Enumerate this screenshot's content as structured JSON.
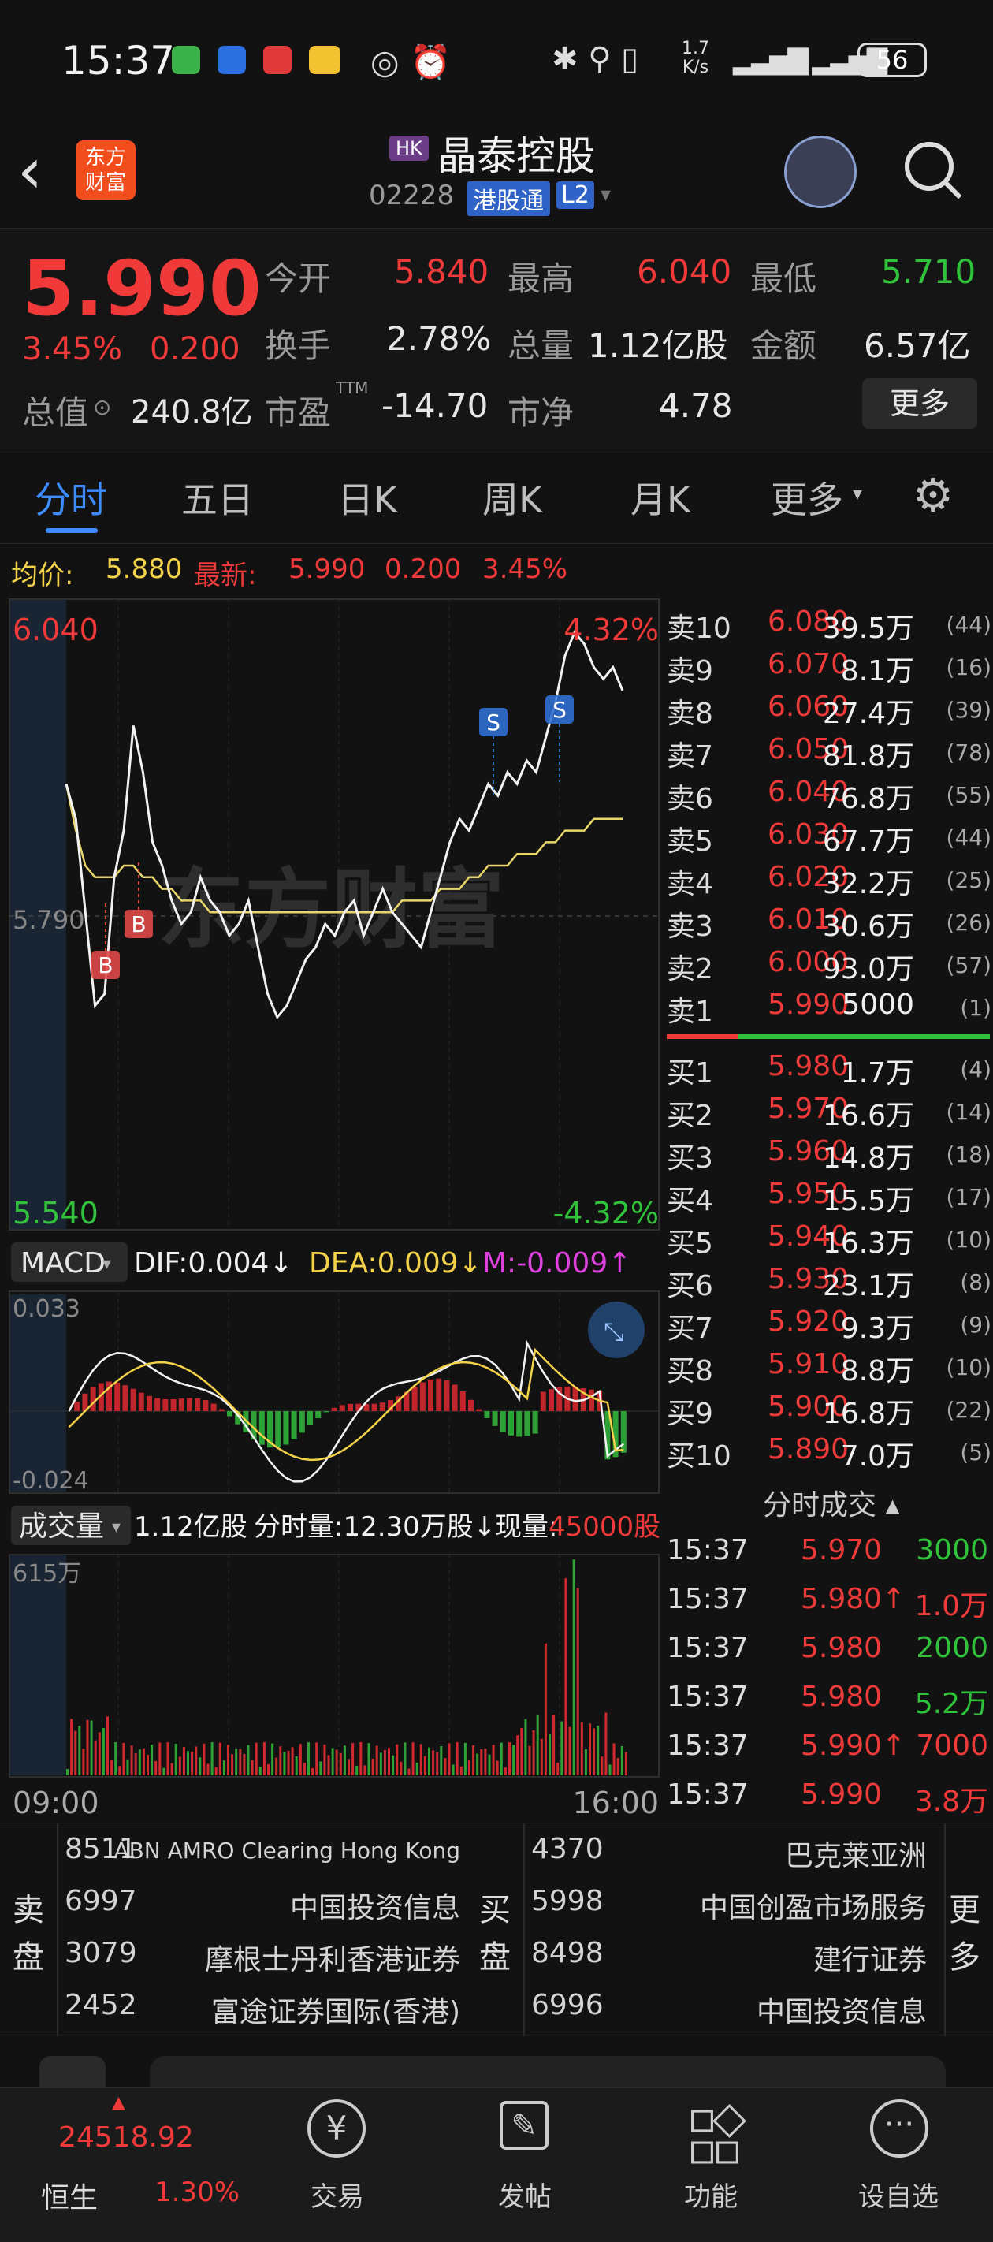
{
  "status_bar": {
    "time": "15:37",
    "net_speed_top": "1.7",
    "net_speed_unit": "K/s",
    "battery": "56"
  },
  "header": {
    "logo_line1": "东方",
    "logo_line2": "财富",
    "market_tag": "HK",
    "stock_name": "晶泰控股",
    "stock_code": "02228",
    "channel_badge": "港股通",
    "level_badge": "L2"
  },
  "quote": {
    "last_price": "5.990",
    "change_pct": "3.45%",
    "change_abs": "0.200",
    "open_label": "今开",
    "open": "5.840",
    "high_label": "最高",
    "high": "6.040",
    "low_label": "最低",
    "low": "5.710",
    "turnover_label": "换手",
    "turnover": "2.78%",
    "volume_label": "总量",
    "volume": "1.12亿股",
    "amount_label": "金额",
    "amount": "6.57亿",
    "mktcap_label": "总值",
    "mktcap": "240.8亿",
    "pe_label": "市盈",
    "pe_sup": "TTM",
    "pe": "-14.70",
    "pb_label": "市净",
    "pb": "4.78",
    "more_button": "更多"
  },
  "tabs": [
    "分时",
    "五日",
    "日K",
    "周K",
    "月K",
    "更多"
  ],
  "active_tab": "分时",
  "price_bar": {
    "avg_label": "均价:",
    "avg": "5.880",
    "latest_label": "最新:",
    "latest": "5.990",
    "chg": "0.200",
    "pct": "3.45%"
  },
  "intraday": {
    "y_max": "6.040",
    "y_min": "5.540",
    "y_mid": "5.790",
    "pct_max": "4.32%",
    "pct_min": "-4.32%",
    "x_start": "09:00",
    "x_end": "16:00",
    "trade_marks": [
      "B",
      "B",
      "S",
      "S"
    ],
    "watermark": "东方财富"
  },
  "macd": {
    "menu": "MACD",
    "dif": "DIF:0.004↓",
    "dea": "DEA:0.009↓",
    "m": "M:-0.009↑",
    "y_top": "0.033",
    "y_bottom": "-0.024"
  },
  "volume_panel": {
    "menu": "成交量",
    "total": "1.12亿股",
    "period": "分时量:12.30万股↓",
    "now_label": "现量:",
    "now": "45000股",
    "y_top": "615万"
  },
  "chart_data": {
    "type": "line",
    "title": "",
    "x_range": [
      "09:00",
      "16:00"
    ],
    "ylim": [
      5.54,
      6.04
    ],
    "series": [
      {
        "name": "",
        "values": [
          5.91,
          5.88,
          5.8,
          5.72,
          5.73,
          5.83,
          5.87,
          5.96,
          5.92,
          5.86,
          5.84,
          5.81,
          5.79,
          5.8,
          5.83,
          5.81,
          5.8,
          5.78,
          5.79,
          5.81,
          5.77,
          5.73,
          5.71,
          5.72,
          5.74,
          5.76,
          5.77,
          5.79,
          5.78,
          5.8,
          5.81,
          5.78,
          5.8,
          5.82,
          5.8,
          5.79,
          5.78,
          5.77,
          5.8,
          5.83,
          5.86,
          5.88,
          5.87,
          5.89,
          5.91,
          5.9,
          5.92,
          5.91,
          5.93,
          5.92,
          5.95,
          5.98,
          6.02,
          6.04,
          6.03,
          6.01,
          6.0,
          6.01,
          5.99
        ]
      },
      {
        "name": "均价",
        "values": [
          5.91,
          5.87,
          5.84,
          5.83,
          5.83,
          5.83,
          5.84,
          5.84,
          5.83,
          5.83,
          5.82,
          5.82,
          5.81,
          5.81,
          5.81,
          5.8,
          5.8,
          5.8,
          5.8,
          5.8,
          5.8,
          5.8,
          5.8,
          5.8,
          5.8,
          5.8,
          5.8,
          5.8,
          5.8,
          5.8,
          5.8,
          5.8,
          5.8,
          5.8,
          5.8,
          5.81,
          5.81,
          5.81,
          5.81,
          5.82,
          5.82,
          5.82,
          5.83,
          5.83,
          5.84,
          5.84,
          5.84,
          5.85,
          5.85,
          5.85,
          5.86,
          5.86,
          5.87,
          5.87,
          5.87,
          5.88,
          5.88,
          5.88,
          5.88
        ]
      }
    ]
  },
  "order_book": {
    "asks": [
      {
        "label": "卖10",
        "price": "6.080",
        "vol": "39.5万",
        "n": "(44)"
      },
      {
        "label": "卖9",
        "price": "6.070",
        "vol": "8.1万",
        "n": "(16)"
      },
      {
        "label": "卖8",
        "price": "6.060",
        "vol": "27.4万",
        "n": "(39)"
      },
      {
        "label": "卖7",
        "price": "6.050",
        "vol": "81.8万",
        "n": "(78)"
      },
      {
        "label": "卖6",
        "price": "6.040",
        "vol": "76.8万",
        "n": "(55)"
      },
      {
        "label": "卖5",
        "price": "6.030",
        "vol": "67.7万",
        "n": "(44)"
      },
      {
        "label": "卖4",
        "price": "6.020",
        "vol": "32.2万",
        "n": "(25)"
      },
      {
        "label": "卖3",
        "price": "6.010",
        "vol": "30.6万",
        "n": "(26)"
      },
      {
        "label": "卖2",
        "price": "6.000",
        "vol": "93.0万",
        "n": "(57)"
      },
      {
        "label": "卖1",
        "price": "5.990",
        "vol": "5000",
        "n": "(1)"
      }
    ],
    "bids": [
      {
        "label": "买1",
        "price": "5.980",
        "vol": "1.7万",
        "n": "(4)"
      },
      {
        "label": "买2",
        "price": "5.970",
        "vol": "16.6万",
        "n": "(14)"
      },
      {
        "label": "买3",
        "price": "5.960",
        "vol": "14.8万",
        "n": "(18)"
      },
      {
        "label": "买4",
        "price": "5.950",
        "vol": "15.5万",
        "n": "(17)"
      },
      {
        "label": "买5",
        "price": "5.940",
        "vol": "16.3万",
        "n": "(10)"
      },
      {
        "label": "买6",
        "price": "5.930",
        "vol": "23.1万",
        "n": "(8)"
      },
      {
        "label": "买7",
        "price": "5.920",
        "vol": "9.3万",
        "n": "(9)"
      },
      {
        "label": "买8",
        "price": "5.910",
        "vol": "8.8万",
        "n": "(10)"
      },
      {
        "label": "买9",
        "price": "5.900",
        "vol": "16.8万",
        "n": "(22)"
      },
      {
        "label": "买10",
        "price": "5.890",
        "vol": "7.0万",
        "n": "(5)"
      }
    ]
  },
  "ticks": {
    "header": "分时成交",
    "rows": [
      {
        "time": "15:37",
        "price": "5.970",
        "vol": "3000"
      },
      {
        "time": "15:37",
        "price": "5.980↑",
        "vol": "1.0万"
      },
      {
        "time": "15:37",
        "price": "5.980",
        "vol": "2000"
      },
      {
        "time": "15:37",
        "price": "5.980",
        "vol": "5.2万"
      },
      {
        "time": "15:37",
        "price": "5.990↑",
        "vol": "7000"
      },
      {
        "time": "15:37",
        "price": "5.990",
        "vol": "3.8万"
      }
    ]
  },
  "brokers": {
    "sell_label": "卖盘",
    "buy_label": "买盘",
    "more_label": "更多",
    "sell": [
      {
        "id": "8511",
        "name": "ABN AMRO Clearing Hong Kong"
      },
      {
        "id": "6997",
        "name": "中国投资信息"
      },
      {
        "id": "3079",
        "name": "摩根士丹利香港证券"
      },
      {
        "id": "2452",
        "name": "富途证券国际(香港)"
      }
    ],
    "buy": [
      {
        "id": "4370",
        "name": "巴克莱亚洲"
      },
      {
        "id": "5998",
        "name": "中国创盈市场服务"
      },
      {
        "id": "8498",
        "name": "建行证券"
      },
      {
        "id": "6996",
        "name": "中国投资信息"
      }
    ]
  },
  "bottom_nav": {
    "index_value": "24518.92",
    "index_name": "恒生",
    "index_pct": "1.30%",
    "items": [
      "交易",
      "发帖",
      "功能",
      "设自选"
    ]
  },
  "colors": {
    "up": "#f03a3a",
    "down": "#31c23b",
    "avg": "#e8d66a",
    "accent": "#3f8cff",
    "bg": "#121212"
  }
}
